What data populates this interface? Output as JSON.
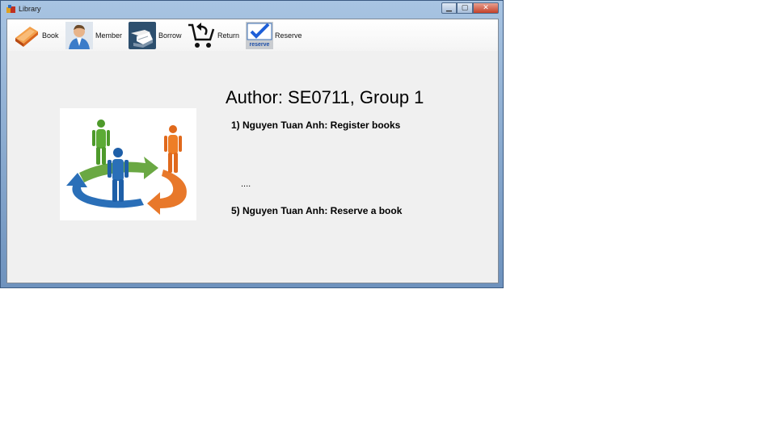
{
  "window": {
    "title": "Library"
  },
  "toolbar": {
    "items": [
      {
        "label": "Book"
      },
      {
        "label": "Member"
      },
      {
        "label": "Borrow"
      },
      {
        "label": "Return"
      },
      {
        "label": "Reserve"
      }
    ],
    "reserve_icon_text": "reserve"
  },
  "content": {
    "heading": "Author: SE0711, Group 1",
    "lines": [
      "1) Nguyen Tuan Anh: Register books",
      "....",
      "5) Nguyen Tuan Anh: Reserve a book"
    ]
  },
  "colors": {
    "accent_blue": "#1e5fa8",
    "green": "#5b9a2e",
    "orange": "#e8781e"
  }
}
